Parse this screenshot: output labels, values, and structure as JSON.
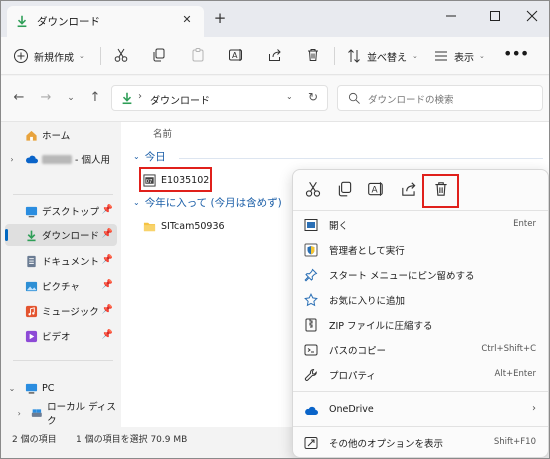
{
  "window": {
    "tab_title": "ダウンロード",
    "new_tab": "+"
  },
  "toolbar": {
    "new_label": "新規作成",
    "sort_label": "並べ替え",
    "view_label": "表示",
    "more": "•••"
  },
  "address": {
    "path": "ダウンロード",
    "separator": "›"
  },
  "search": {
    "placeholder": "ダウンロードの検索"
  },
  "sidebar": {
    "items": [
      {
        "label": "ホーム"
      },
      {
        "label": "- 個人用"
      },
      {
        "label": "デスクトップ"
      },
      {
        "label": "ダウンロード"
      },
      {
        "label": "ドキュメント"
      },
      {
        "label": "ピクチャ"
      },
      {
        "label": "ミュージック"
      },
      {
        "label": "ビデオ"
      },
      {
        "label": "PC"
      },
      {
        "label": "ローカル ディスク"
      }
    ]
  },
  "content": {
    "col_name": "名前",
    "group_today": "今日",
    "group_month": "今年に入って (今月は含めず)",
    "files": [
      {
        "name": "E1035102"
      },
      {
        "name": "SITcam50936"
      }
    ]
  },
  "context_menu": {
    "items": [
      {
        "label": "開く",
        "shortcut": "Enter"
      },
      {
        "label": "管理者として実行",
        "shortcut": ""
      },
      {
        "label": "スタート メニューにピン留めする",
        "shortcut": ""
      },
      {
        "label": "お気に入りに追加",
        "shortcut": ""
      },
      {
        "label": "ZIP ファイルに圧縮する",
        "shortcut": ""
      },
      {
        "label": "パスのコピー",
        "shortcut": "Ctrl+Shift+C"
      },
      {
        "label": "プロパティ",
        "shortcut": "Alt+Enter"
      },
      {
        "label": "OneDrive",
        "shortcut": ""
      },
      {
        "label": "その他のオプションを表示",
        "shortcut": "Shift+F10"
      }
    ]
  },
  "status": {
    "count": "2 個の項目",
    "selection": "1 個の項目を選択  70.9 MB"
  },
  "colors": {
    "accent": "#0067c0",
    "highlight": "#e0201b",
    "folder": "#f5c342",
    "download": "#2e9e57"
  }
}
